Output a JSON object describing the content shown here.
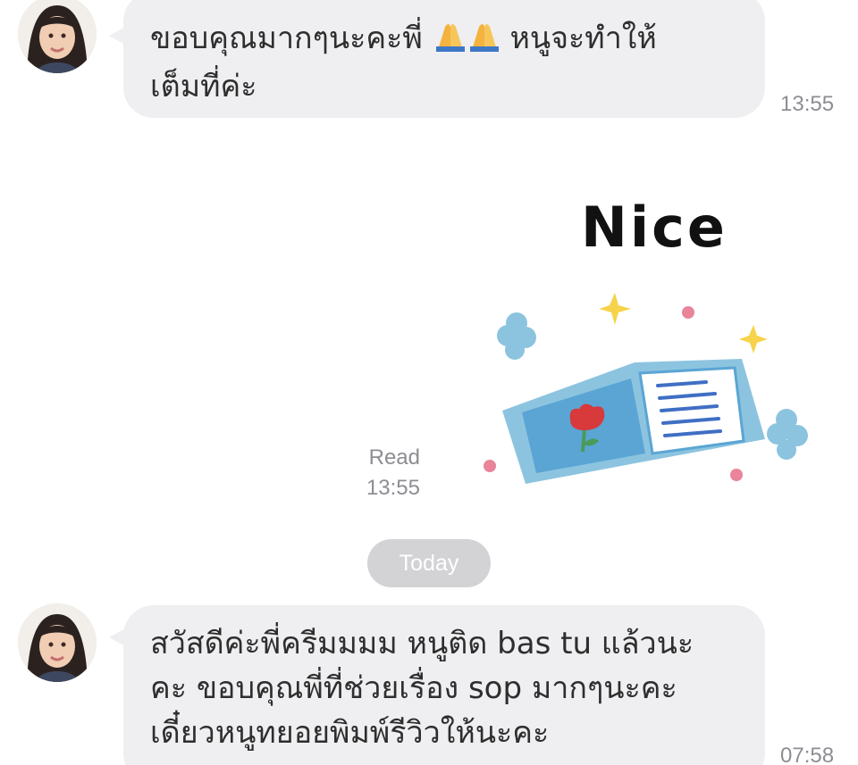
{
  "messages": {
    "first": {
      "lines": [
        "ขอบคุณมากๆนะคะพี่",
        "หนูจะทำให้",
        "เต็มที่ค่ะ"
      ],
      "emoji": "🙏🙏",
      "time": "13:55"
    },
    "sticker": {
      "text": "Nice",
      "read_label": "Read",
      "time": "13:55"
    },
    "date_separator": "Today",
    "second": {
      "lines": [
        "สวัสดีค่ะพี่ครีมมมม หนูติด bas tu แล้วนะ",
        "คะ ขอบคุณพี่ที่ช่วยเรื่อง sop มากๆนะคะ",
        "เดี๋ยวหนูทยอยพิมพ์รีวิวให้นะคะ"
      ],
      "time": "07:58"
    }
  },
  "colors": {
    "bubble": "#efeff1",
    "timestamp": "#8d8d93",
    "date_pill": "#d3d3d6"
  }
}
